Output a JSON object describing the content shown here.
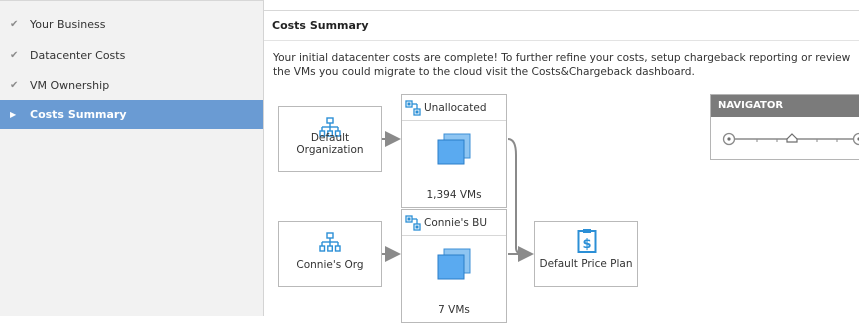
{
  "sidebar": {
    "items": [
      {
        "label": "Your Business",
        "mark": "✔",
        "active": false
      },
      {
        "label": "Datacenter Costs",
        "mark": "✔",
        "active": false
      },
      {
        "label": "VM Ownership",
        "mark": "✔",
        "active": false
      },
      {
        "label": "Costs Summary",
        "mark": "▶",
        "active": true
      }
    ]
  },
  "main": {
    "title": "Costs Summary",
    "description": "Your initial datacenter costs are complete! To further refine your costs, setup chargeback reporting or review the VMs you could migrate to the cloud visit the Costs&Chargeback dashboard."
  },
  "diagram": {
    "orgs": [
      {
        "label": "Default Organization"
      },
      {
        "label": "Connie's Org"
      }
    ],
    "business_units": [
      {
        "name": "Unallocated",
        "vm_count": "1,394 VMs"
      },
      {
        "name": "Connie's BU",
        "vm_count": "7 VMs"
      }
    ],
    "price_plan": {
      "label": "Default Price Plan"
    }
  },
  "navigator": {
    "title": "NAVIGATOR"
  },
  "colors": {
    "accent": "#6a9bd3",
    "icon_blue": "#2b8fd6",
    "header_gray": "#7b7b7b"
  }
}
